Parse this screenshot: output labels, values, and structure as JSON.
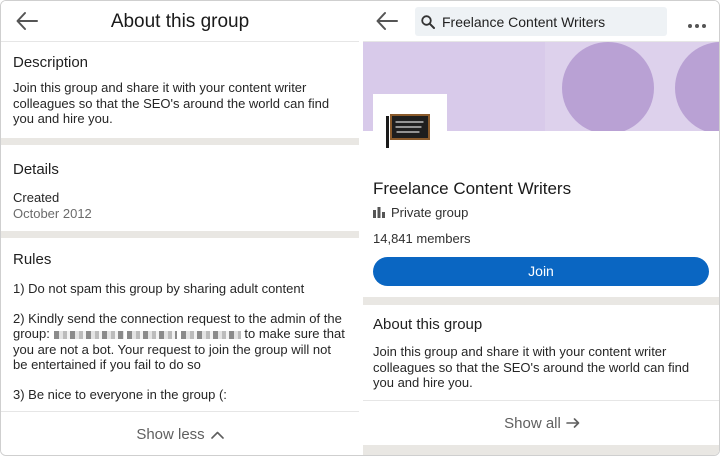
{
  "left": {
    "header": {
      "title": "About this group",
      "back_icon": "arrow-left-icon"
    },
    "description": {
      "title": "Description",
      "text": "Join this group and share it with your content writer colleagues so that the SEO's around the world can find you and hire you."
    },
    "details": {
      "title": "Details",
      "created_label": "Created",
      "created_value": "October 2012"
    },
    "rules": {
      "title": "Rules",
      "items": [
        {
          "text": "1) Do not spam this group by sharing adult content"
        },
        {
          "text_before": "2) Kindly send the connection request to the admin of the group:",
          "text_after": "to make sure that you are not a bot. Your request to join the group will not be entertained if you fail to do so"
        },
        {
          "text": "3) Be nice to everyone in the group (:"
        }
      ]
    },
    "show_less": {
      "label": "Show less",
      "icon": "chevron-up-icon"
    }
  },
  "right": {
    "header": {
      "back_icon": "arrow-left-icon",
      "search_icon": "search-icon",
      "search_value": "Freelance Content Writers",
      "more_icon": "more-dots-icon"
    },
    "group": {
      "name": "Freelance Content Writers",
      "privacy": "Private group",
      "privacy_icon": "building-icon",
      "members": "14,841 members",
      "join_label": "Join"
    },
    "about": {
      "title": "About this group",
      "text": "Join this group and share it with your content writer colleagues so that the SEO's around the world can find you and hire you."
    },
    "show_all": {
      "label": "Show all",
      "icon": "arrow-right-icon"
    }
  },
  "colors": {
    "primary": "#0a66c2",
    "banner": "#ddd1ec",
    "banner_circle": "#b9a1d4",
    "separator": "#e9e7e3"
  }
}
